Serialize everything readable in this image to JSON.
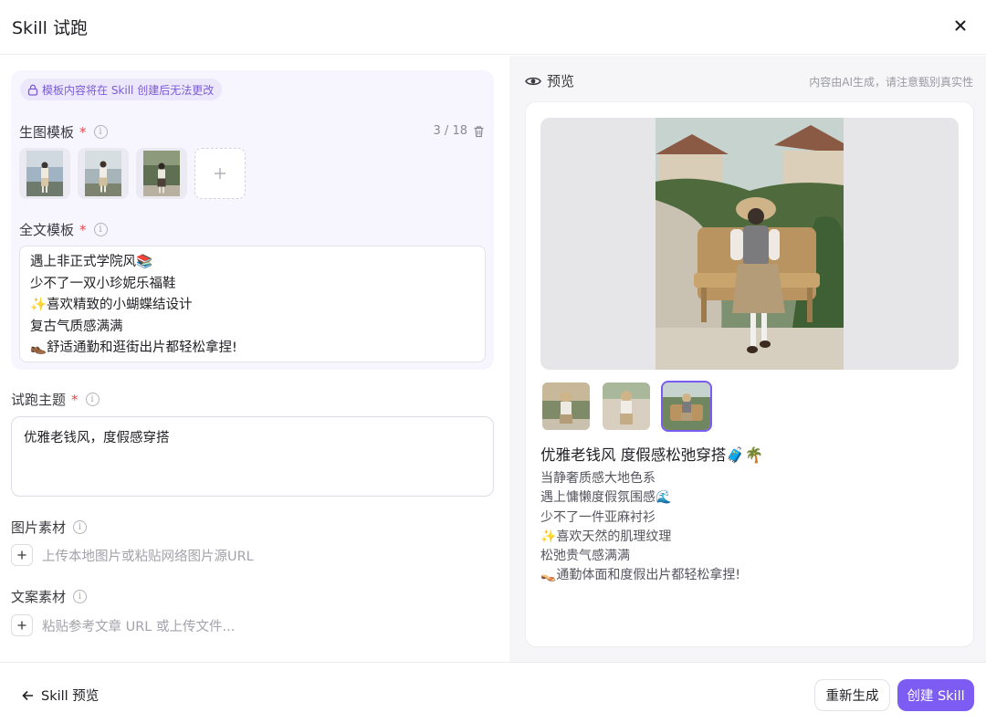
{
  "dialog": {
    "title": "Skill 试跑"
  },
  "template_section": {
    "lock_notice": "模板内容将在 Skill 创建后无法更改",
    "image_template": {
      "label": "生图模板",
      "required_mark": "*",
      "count": "3 / 18"
    },
    "text_template": {
      "label": "全文模板",
      "required_mark": "*",
      "lines": [
        "遇上非正式学院风📚",
        "少不了一双小珍妮乐福鞋",
        "✨喜欢精致的小蝴蝶结设计",
        "复古气质感满满",
        "👞舒适通勤和逛街出片都轻松拿捏!"
      ]
    }
  },
  "theme": {
    "label": "试跑主题",
    "required_mark": "*",
    "value": "优雅老钱风，度假感穿搭"
  },
  "image_material": {
    "label": "图片素材",
    "placeholder": "上传本地图片或粘贴网络图片源URL"
  },
  "text_material": {
    "label": "文案素材",
    "placeholder": "粘贴参考文章 URL 或上传文件..."
  },
  "preview": {
    "label": "预览",
    "ai_note": "内容由AI生成，请注意甄别真实性",
    "selected_thumb": 3,
    "post_title": "优雅老钱风 度假感松弛穿搭🧳🌴",
    "post_lines": [
      "当静奢质感大地色系",
      "遇上慵懒度假氛围感🌊",
      "少不了一件亚麻衬衫",
      "✨喜欢天然的肌理纹理",
      "松弛贵气感满满",
      "👡通勤体面和度假出片都轻松拿捏!"
    ]
  },
  "footer": {
    "back_label": "Skill 预览",
    "regenerate_label": "重新生成",
    "create_label": "创建 Skill"
  },
  "colors": {
    "accent": "#7c5cf2",
    "template_bg": "#f7f5fe",
    "required": "#e5484d"
  },
  "icons": [
    "close-icon",
    "lock-icon",
    "info-icon",
    "trash-icon",
    "plus-icon",
    "eye-icon",
    "arrow-left-icon"
  ]
}
